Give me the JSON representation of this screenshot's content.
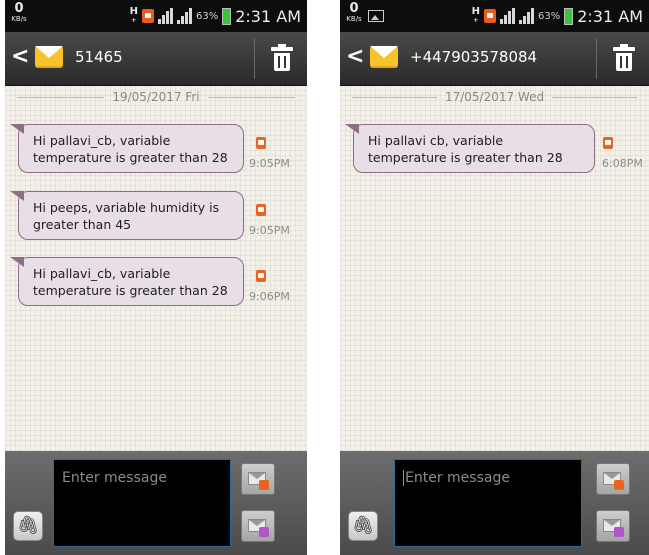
{
  "left": {
    "status": {
      "speed": "0",
      "speed_unit": "KB/s",
      "net": "H",
      "net_sub": "+",
      "battery": "63%",
      "time": "2:31 AM"
    },
    "header": {
      "back": "<",
      "contact": "51465"
    },
    "date": "19/05/2017 Fri",
    "messages": [
      {
        "line1": "Hi pallavi_cb, variable",
        "line2": "temperature is greater than 28",
        "time": "9:05PM"
      },
      {
        "line1": "Hi peeps, variable humidity is",
        "line2": "greater than 45",
        "time": "9:05PM"
      },
      {
        "line1": "Hi pallavi_cb, variable",
        "line2": "temperature is greater than 28",
        "time": "9:06PM"
      }
    ],
    "composer": {
      "placeholder": "Enter message"
    }
  },
  "right": {
    "status": {
      "speed": "0",
      "speed_unit": "KB/s",
      "net": "H",
      "net_sub": "+",
      "battery": "63%",
      "time": "2:31 AM"
    },
    "header": {
      "back": "<",
      "contact": "+447903578084"
    },
    "date": "17/05/2017 Wed",
    "messages": [
      {
        "line1": "Hi pallavi cb, variable",
        "line2": "temperature is greater than 28",
        "time": "6:08PM"
      }
    ],
    "composer": {
      "placeholder": "Enter message"
    }
  },
  "colors": {
    "bubble_fill": "#e8dfe6",
    "bubble_border": "#8f6d86",
    "accent_orange": "#e9651f",
    "input_border": "#2d6b96"
  }
}
